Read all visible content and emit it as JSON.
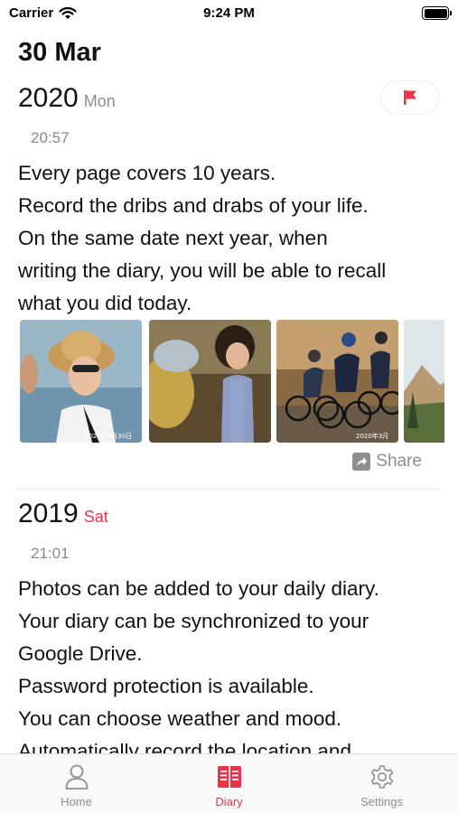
{
  "status_bar": {
    "carrier": "Carrier",
    "time": "9:24 PM"
  },
  "page": {
    "date_title": "30 Mar"
  },
  "entries": [
    {
      "year": "2020",
      "weekday": "Mon",
      "time": "20:57",
      "text": "Every page covers 10 years.\nRecord the dribs and drabs of your life.\nOn the same date next year, when\nwriting the diary, you will be able to recall\nwhat you did today.",
      "photos": [
        {
          "caption": "2020年3月30日"
        },
        {
          "caption": ""
        },
        {
          "caption": "2020年3月"
        },
        {
          "caption": ""
        }
      ],
      "share_label": "Share"
    },
    {
      "year": "2019",
      "weekday": "Sat",
      "time": "21:01",
      "text": "Photos can be added to your daily diary.\nYour diary can be synchronized to your\nGoogle Drive.\nPassword protection is available.\nYou can choose weather and mood.\nAutomatically record the location and"
    }
  ],
  "tabs": [
    {
      "label": "Home",
      "icon": "person-icon"
    },
    {
      "label": "Diary",
      "icon": "diary-book-icon"
    },
    {
      "label": "Settings",
      "icon": "gear-icon"
    }
  ],
  "colors": {
    "accent": "#e8344b",
    "weekday_gray": "#8e8e8e",
    "text": "#111111"
  }
}
